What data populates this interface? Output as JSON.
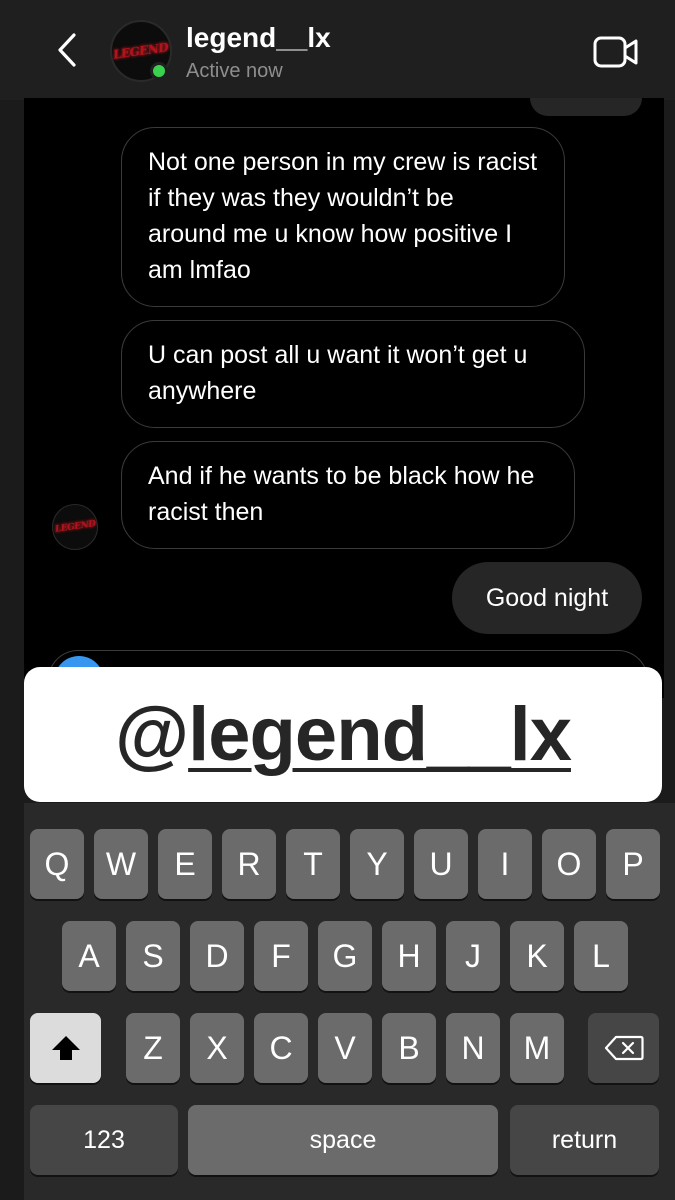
{
  "header": {
    "username": "legend__lx",
    "status": "Active now",
    "avatar_text": "LEGEND"
  },
  "messages": [
    {
      "from": "them",
      "text": "Not one person in my crew is racist if they was they wouldn’t be around me u know how positive I am lmfao"
    },
    {
      "from": "them",
      "text": "U can post all u want it won’t get u anywhere"
    },
    {
      "from": "them",
      "text": "And if he wants to be black how he racist then"
    },
    {
      "from": "me",
      "text": "Good night"
    }
  ],
  "sticker": {
    "at": "@",
    "handle": "legend__lx"
  },
  "keyboard": {
    "row1": [
      "Q",
      "W",
      "E",
      "R",
      "T",
      "Y",
      "U",
      "I",
      "O",
      "P"
    ],
    "row2": [
      "A",
      "S",
      "D",
      "F",
      "G",
      "H",
      "J",
      "K",
      "L"
    ],
    "row3": [
      "Z",
      "X",
      "C",
      "V",
      "B",
      "N",
      "M"
    ],
    "numbers_label": "123",
    "space_label": "space",
    "return_label": "return"
  },
  "colors": {
    "online": "#3ad14e",
    "bubble_border": "#3a3a3a",
    "sent_bubble": "#262626",
    "composer_accent": "#3797f0",
    "logo_red": "#b3141c"
  },
  "icons": {
    "back": "chevron-left-icon",
    "video": "video-camera-icon",
    "shift": "shift-arrow-icon",
    "delete": "backspace-icon"
  }
}
